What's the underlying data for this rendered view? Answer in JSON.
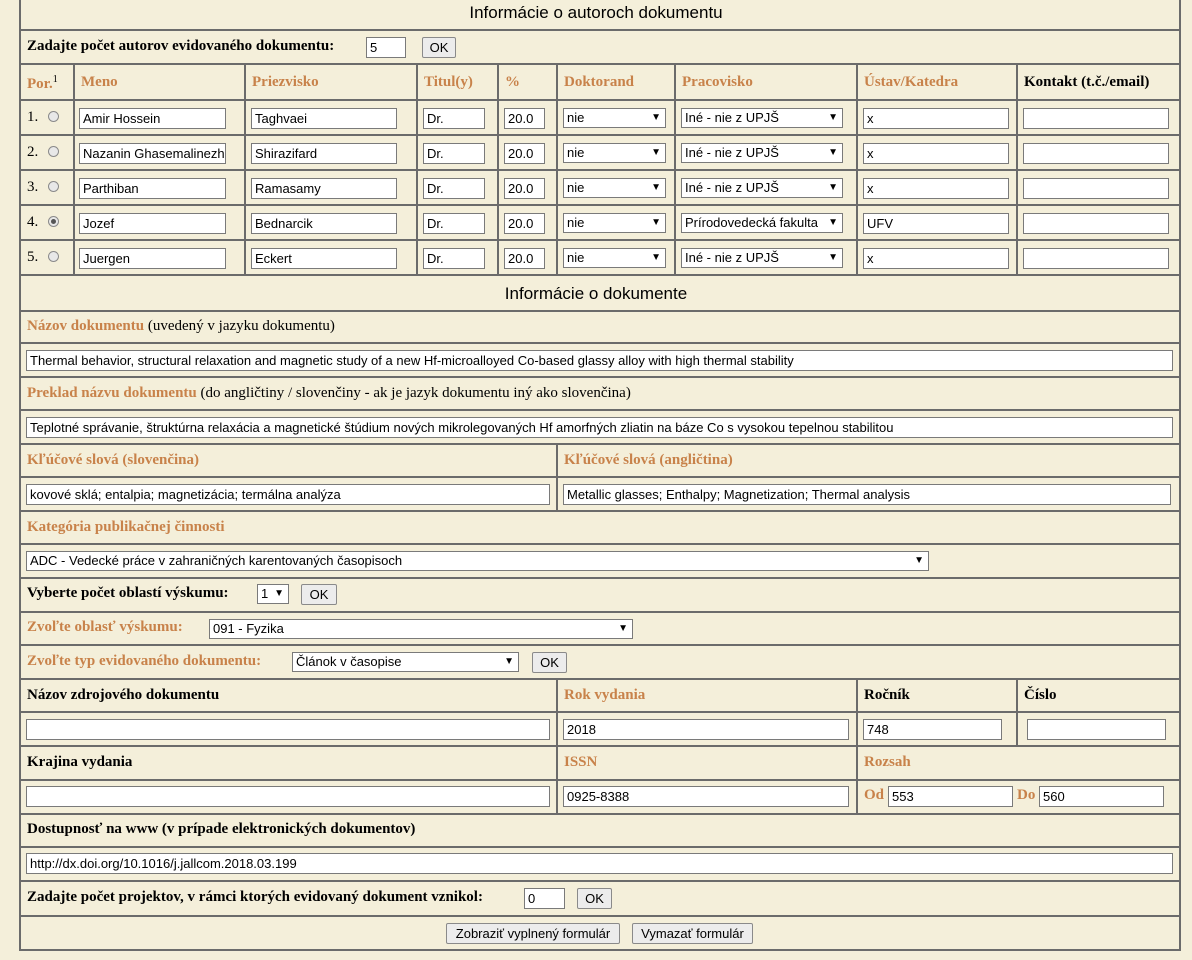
{
  "authors_section": {
    "title": "Informácie o autoroch dokumentu",
    "count_label": "Zadajte počet autorov evidovaného dokumentu:",
    "count_value": "5",
    "ok_label": "OK",
    "headers": {
      "por": "Por.",
      "por_sup": "1",
      "meno": "Meno",
      "priezvisko": "Priezvisko",
      "titul": "Titul(y)",
      "pct": "%",
      "doktorand": "Doktorand",
      "pracovisko": "Pracovisko",
      "ustav": "Ústav/Katedra",
      "kontakt": "Kontakt (t.č./email)"
    },
    "rows": [
      {
        "num": "1.",
        "meno": "Amir Hossein",
        "priezvisko": "Taghvaei",
        "titul": "Dr.",
        "pct": "20.0",
        "doktorand": "nie",
        "pracovisko": "Iné - nie z UPJŠ",
        "ustav": "x",
        "kontakt": "",
        "selected": false
      },
      {
        "num": "2.",
        "meno": "Nazanin Ghasemalinezh",
        "priezvisko": "Shirazifard",
        "titul": "Dr.",
        "pct": "20.0",
        "doktorand": "nie",
        "pracovisko": "Iné - nie z UPJŠ",
        "ustav": "x",
        "kontakt": "",
        "selected": false
      },
      {
        "num": "3.",
        "meno": "Parthiban",
        "priezvisko": "Ramasamy",
        "titul": "Dr.",
        "pct": "20.0",
        "doktorand": "nie",
        "pracovisko": "Iné - nie z UPJŠ",
        "ustav": "x",
        "kontakt": "",
        "selected": false
      },
      {
        "num": "4.",
        "meno": "Jozef",
        "priezvisko": "Bednarcik",
        "titul": "Dr.",
        "pct": "20.0",
        "doktorand": "nie",
        "pracovisko": "Prírodovedecká fakulta",
        "ustav": "UFV",
        "kontakt": "",
        "selected": true
      },
      {
        "num": "5.",
        "meno": "Juergen",
        "priezvisko": "Eckert",
        "titul": "Dr.",
        "pct": "20.0",
        "doktorand": "nie",
        "pracovisko": "Iné - nie z UPJŠ",
        "ustav": "x",
        "kontakt": "",
        "selected": false
      }
    ]
  },
  "document_section": {
    "title": "Informácie o dokumente",
    "nazov_label": "Názov dokumentu",
    "nazov_note": "(uvedený v jazyku dokumentu)",
    "nazov_value": "Thermal behavior, structural relaxation and magnetic study of a new Hf-microalloyed Co-based glassy alloy with high thermal stability",
    "preklad_label": "Preklad názvu dokumentu",
    "preklad_note": "(do angličtiny / slovenčiny - ak je jazyk dokumentu iný ako slovenčina)",
    "preklad_value": "Teplotné správanie, štruktúrna relaxácia a magnetické štúdium nových mikrolegovaných Hf amorfných zliatin na báze Co s vysokou tepelnou stabilitou",
    "kw_sk_label": "Kľúčové slová (slovenčina)",
    "kw_sk_value": "kovové sklá; entalpia; magnetizácia; termálna analýza",
    "kw_en_label": "Kľúčové slová (angličtina)",
    "kw_en_value": "Metallic glasses; Enthalpy; Magnetization; Thermal analysis",
    "kategoria_label": "Kategória publikačnej činnosti",
    "kategoria_value": "ADC - Vedecké práce v zahraničných karentovaných časopisoch",
    "oblasti_label": "Vyberte počet oblastí výskumu:",
    "oblasti_value": "1",
    "oblast_label": "Zvoľte oblasť výskumu:",
    "oblast_value": "091 - Fyzika",
    "typ_label": "Zvoľte typ evidovaného dokumentu:",
    "typ_value": "Článok v časopise",
    "ok_label": "OK",
    "zdroj_label": "Názov zdrojového dokumentu",
    "zdroj_value": "",
    "rok_label": "Rok vydania",
    "rok_value": "2018",
    "rocnik_label": "Ročník",
    "rocnik_value": "748",
    "cislo_label": "Číslo",
    "cislo_value": "",
    "krajina_label": "Krajina vydania",
    "krajina_value": "",
    "issn_label": "ISSN",
    "issn_value": "0925-8388",
    "rozsah_label": "Rozsah",
    "od_label": "Od",
    "od_value": "553",
    "do_label": "Do",
    "do_value": "560",
    "www_label": "Dostupnosť na www (v prípade elektronických dokumentov)",
    "www_value": "http://dx.doi.org/10.1016/j.jallcom.2018.03.199",
    "projekty_label": "Zadajte počet projektov, v rámci ktorých evidovaný dokument vznikol:",
    "projekty_value": "0",
    "show_button": "Zobraziť vyplnený formulár",
    "clear_button": "Vymazať formulár"
  }
}
